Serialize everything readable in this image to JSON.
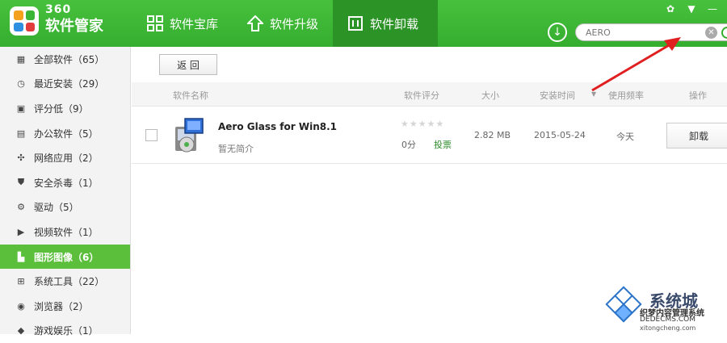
{
  "app": {
    "brand_top": "360",
    "brand_bottom": "软件管家"
  },
  "nav": {
    "items": [
      {
        "label": "软件宝库",
        "icon": "grid-icon"
      },
      {
        "label": "软件升级",
        "icon": "upgrade-arrow-icon"
      },
      {
        "label": "软件卸载",
        "icon": "trash-icon",
        "active": true
      }
    ]
  },
  "window_controls": {
    "skin": "✿",
    "menu": "▼",
    "minimize": "—"
  },
  "search": {
    "value": "AERO"
  },
  "sidebar": {
    "items": [
      {
        "label": "全部软件（65）",
        "icon": "grid-icon"
      },
      {
        "label": "最近安装（29）",
        "icon": "clock-icon"
      },
      {
        "label": "评分低（9）",
        "icon": "rating-icon"
      },
      {
        "label": "办公软件（5）",
        "icon": "printer-icon"
      },
      {
        "label": "网络应用（2）",
        "icon": "network-icon"
      },
      {
        "label": "安全杀毒（1）",
        "icon": "shield-icon"
      },
      {
        "label": "驱动（5）",
        "icon": "gear-icon"
      },
      {
        "label": "视频软件（1）",
        "icon": "play-icon"
      },
      {
        "label": "图形图像（6）",
        "icon": "image-icon",
        "active": true
      },
      {
        "label": "系统工具（22）",
        "icon": "windows-icon"
      },
      {
        "label": "浏览器（2）",
        "icon": "globe-icon"
      },
      {
        "label": "游戏娱乐（1）",
        "icon": "game-icon"
      }
    ]
  },
  "main": {
    "back_label": "返 回",
    "columns": {
      "name": "软件名称",
      "rating": "软件评分",
      "size": "大小",
      "install_time": "安装时间",
      "sort_indicator": "▼",
      "frequency": "使用频率",
      "action": "操作"
    },
    "rows": [
      {
        "name": "Aero Glass for Win8.1",
        "description": "暂无简介",
        "stars": "★★★★★",
        "score": "0分",
        "vote_label": "投票",
        "size": "2.82 MB",
        "install_date": "2015-05-24",
        "frequency": "今天",
        "uninstall_label": "卸载"
      }
    ]
  },
  "watermark": {
    "line1": "系统城",
    "line2": "织梦内容管理系统",
    "line3": "DEDECMS.COM",
    "line4": "xitongcheng.com"
  },
  "colors": {
    "header_green": "#3bb535",
    "active_nav": "#2c9327",
    "sidebar_active": "#5bbf3c",
    "arrow_red": "#e02020"
  }
}
